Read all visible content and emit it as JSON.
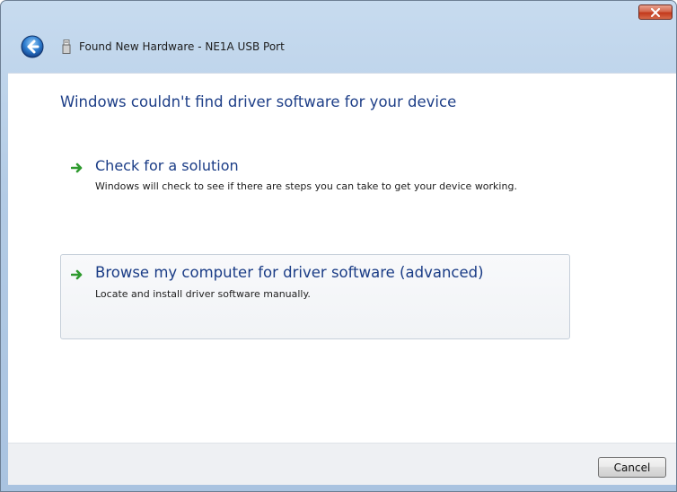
{
  "window": {
    "title": "Found New Hardware - NE1A USB Port",
    "close_icon": "close-icon",
    "back_icon": "back-arrow-icon",
    "device_icon": "usb-device-icon"
  },
  "main": {
    "heading": "Windows couldn't find driver software for your device",
    "options": [
      {
        "title": "Check for a solution",
        "description": "Windows will check to see if there are steps you can take to get your device working.",
        "icon": "green-arrow-icon"
      },
      {
        "title": "Browse my computer for driver software (advanced)",
        "description": "Locate and install driver software manually.",
        "icon": "green-arrow-icon"
      }
    ]
  },
  "footer": {
    "cancel_label": "Cancel"
  },
  "colors": {
    "heading": "#1e3f88",
    "option_title": "#1a3c86",
    "arrow": "#2e9a2e",
    "close_button": "#c7432a"
  }
}
